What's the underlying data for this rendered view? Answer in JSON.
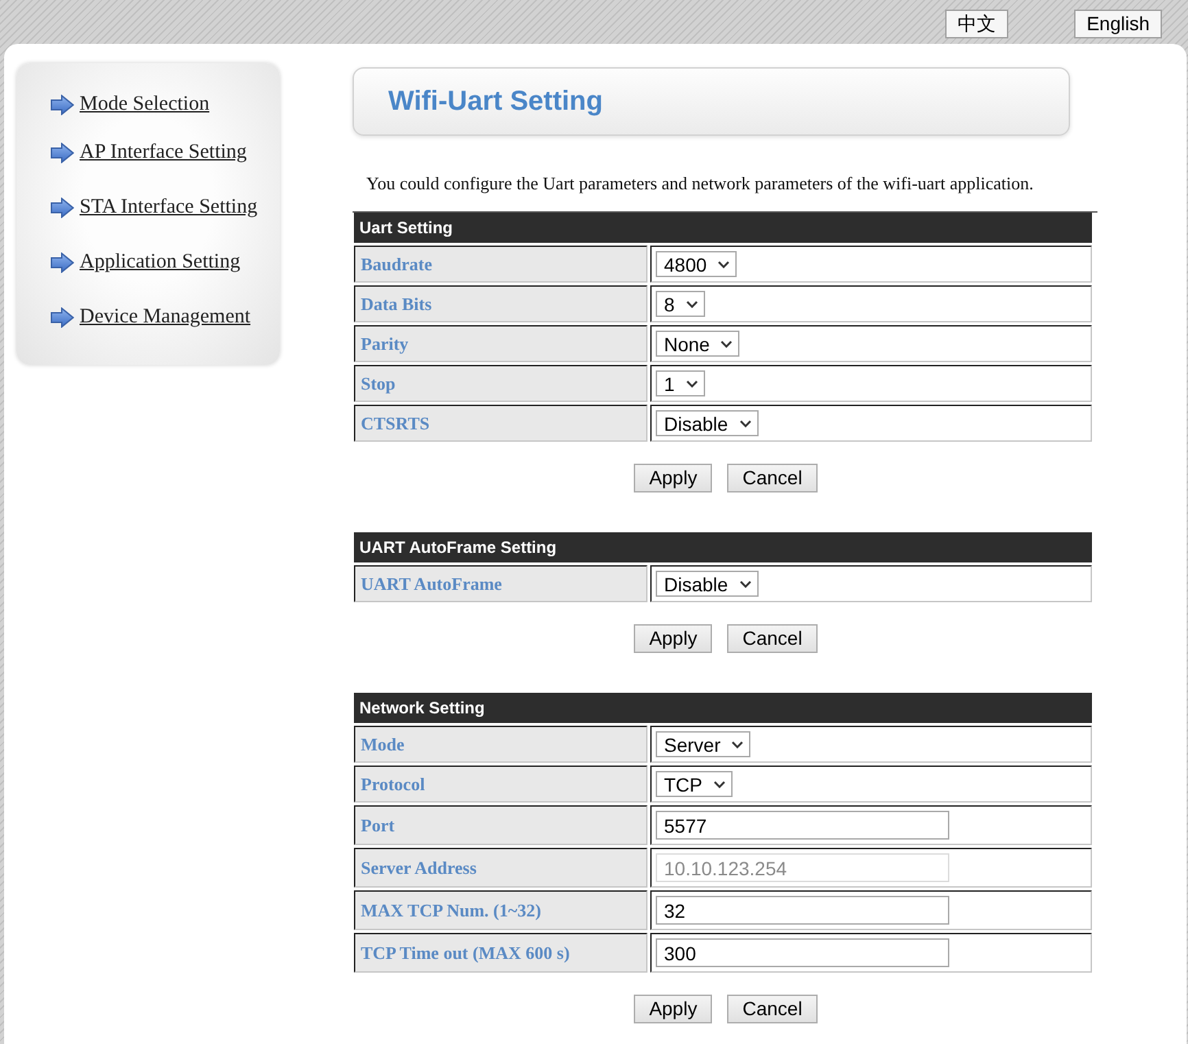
{
  "language_buttons": [
    {
      "label": "中文"
    },
    {
      "label": "English"
    }
  ],
  "sidebar": {
    "items": [
      {
        "label": "Mode Selection"
      },
      {
        "label": "AP Interface Setting"
      },
      {
        "label": "STA Interface Setting"
      },
      {
        "label": "Application Setting"
      },
      {
        "label": "Device Management"
      }
    ]
  },
  "page_title": "Wifi-Uart Setting",
  "description": "You could configure the Uart parameters and network parameters of the wifi-uart application.",
  "sections": [
    {
      "title": "Uart Setting",
      "rows": [
        {
          "label": "Baudrate",
          "kind": "select",
          "value": "4800",
          "disabled": false
        },
        {
          "label": "Data Bits",
          "kind": "select",
          "value": "8",
          "disabled": false
        },
        {
          "label": "Parity",
          "kind": "select",
          "value": "None",
          "disabled": false
        },
        {
          "label": "Stop",
          "kind": "select",
          "value": "1",
          "disabled": false
        },
        {
          "label": "CTSRTS",
          "kind": "select",
          "value": "Disable",
          "disabled": false
        }
      ],
      "buttons": [
        {
          "label": "Apply"
        },
        {
          "label": "Cancel"
        }
      ]
    },
    {
      "title": "UART AutoFrame Setting",
      "rows": [
        {
          "label": "UART AutoFrame",
          "kind": "select",
          "value": "Disable",
          "disabled": false
        }
      ],
      "buttons": [
        {
          "label": "Apply"
        },
        {
          "label": "Cancel"
        }
      ]
    },
    {
      "title": "Network Setting",
      "rows": [
        {
          "label": "Mode",
          "kind": "select",
          "value": "Server",
          "disabled": false
        },
        {
          "label": "Protocol",
          "kind": "select",
          "value": "TCP",
          "disabled": false
        },
        {
          "label": "Port",
          "kind": "input",
          "value": "5577",
          "disabled": false
        },
        {
          "label": "Server Address",
          "kind": "input",
          "value": "10.10.123.254",
          "disabled": true
        },
        {
          "label": "MAX TCP Num. (1~32)",
          "kind": "input",
          "value": "32",
          "disabled": false
        },
        {
          "label": "TCP Time out (MAX 600 s)",
          "kind": "input",
          "value": "300",
          "disabled": false
        }
      ],
      "buttons": [
        {
          "label": "Apply"
        },
        {
          "label": "Cancel"
        }
      ]
    }
  ]
}
